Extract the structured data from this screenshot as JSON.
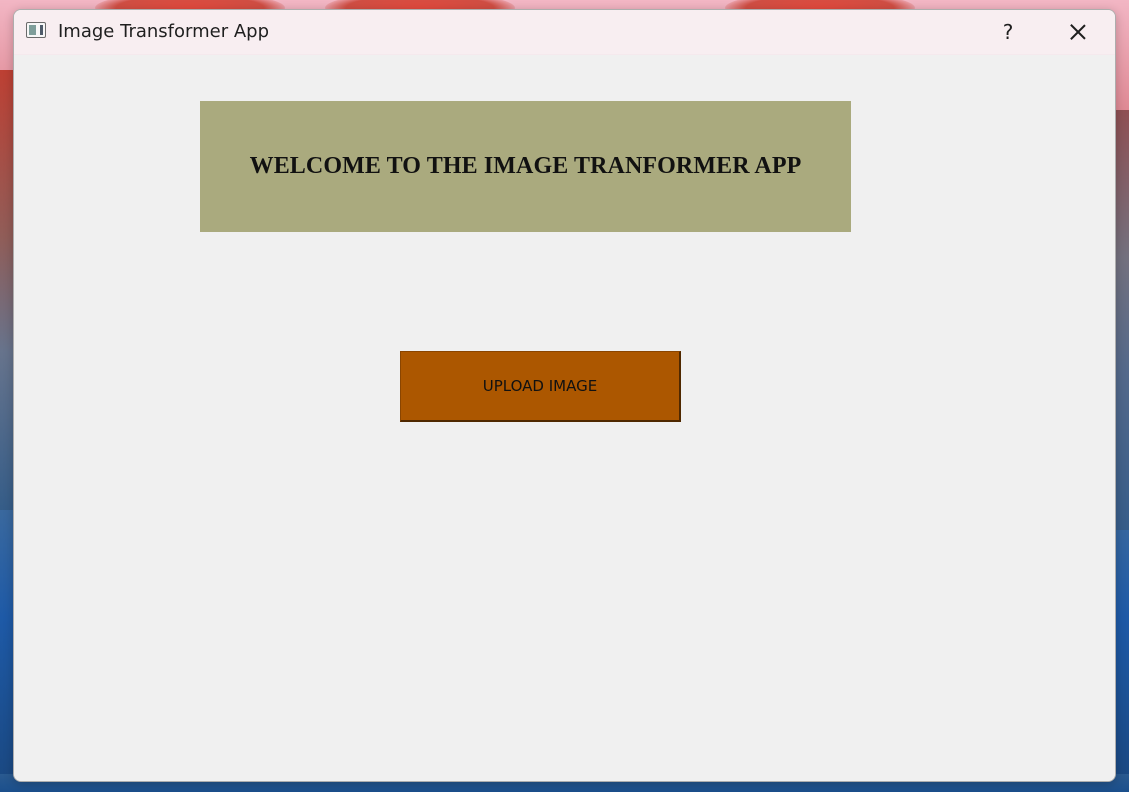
{
  "window": {
    "title": "Image Transformer App",
    "help_label": "?",
    "close_icon": "close-icon",
    "app_icon": "window-app-icon"
  },
  "main": {
    "banner_text": "WELCOME TO THE IMAGE TRANFORMER APP",
    "upload_button_label": "UPLOAD IMAGE"
  },
  "colors": {
    "banner_background": "#aaaa7e",
    "upload_button_background": "#ac5700",
    "window_background": "#f0f0f0",
    "titlebar_background": "#f8eef1"
  }
}
